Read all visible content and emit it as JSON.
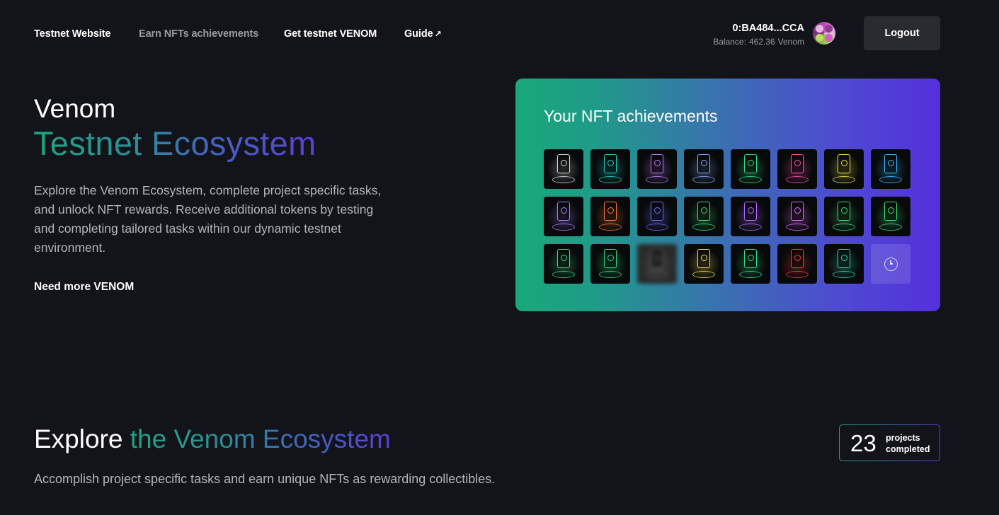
{
  "nav": {
    "links": [
      {
        "label": "Testnet Website",
        "active": false
      },
      {
        "label": "Earn NFTs achievements",
        "active": true
      },
      {
        "label": "Get testnet VENOM",
        "active": false
      },
      {
        "label": "Guide",
        "external_icon": "arrow-up-right-icon"
      }
    ],
    "external_glyph": "↗"
  },
  "wallet": {
    "address": "0:BA484...CCA",
    "balance_label": "Balance:",
    "balance_value": "462.36",
    "balance_unit": "Venom",
    "avatar_icon": "avatar-icon"
  },
  "logout_label": "Logout",
  "hero": {
    "title_line1": "Venom",
    "title_line2": "Testnet Ecosystem",
    "description": "Explore the Venom Ecosystem, complete project specific tasks, and unlock NFT rewards. Receive additional tokens by testing and completing tailored tasks within our dynamic testnet environment.",
    "cta": "Need more VENOM"
  },
  "nft_card": {
    "title": "Your NFT achievements",
    "tiles": [
      {
        "color": "#d8d8d8"
      },
      {
        "color": "#21d6c6"
      },
      {
        "color": "#c27cff"
      },
      {
        "color": "#8aa9ff"
      },
      {
        "color": "#2fe08a"
      },
      {
        "color": "#ff4fb0"
      },
      {
        "color": "#f5e34a"
      },
      {
        "color": "#41b8ff"
      },
      {
        "color": "#a77cff"
      },
      {
        "color": "#ff7a3d"
      },
      {
        "color": "#6f6cff"
      },
      {
        "color": "#3ee07a"
      },
      {
        "color": "#b06cff"
      },
      {
        "color": "#e06cff"
      },
      {
        "color": "#3ee07a"
      },
      {
        "color": "#3ee07a"
      },
      {
        "color": "#2fe08a"
      },
      {
        "color": "#2fe08a"
      },
      {
        "color": "#777777",
        "blurred": true
      },
      {
        "color": "#f5e34a"
      },
      {
        "color": "#2fe08a"
      },
      {
        "color": "#ff3b3b"
      },
      {
        "color": "#2fe0a8"
      },
      {
        "pending": true,
        "icon": "clock-icon"
      }
    ]
  },
  "explore": {
    "title_word": "Explore",
    "title_gradient": "the Venom Ecosystem",
    "subtitle": "Accomplish project specific tasks and earn unique NFTs as rewarding collectibles.",
    "projects_count": "23",
    "projects_label": "projects completed"
  },
  "colors": {
    "background": "#13131a",
    "accent_start": "#1fa57f",
    "accent_end": "#5a3fd7",
    "button_bg": "#2a2b31",
    "muted_text": "#9a9aa3"
  }
}
